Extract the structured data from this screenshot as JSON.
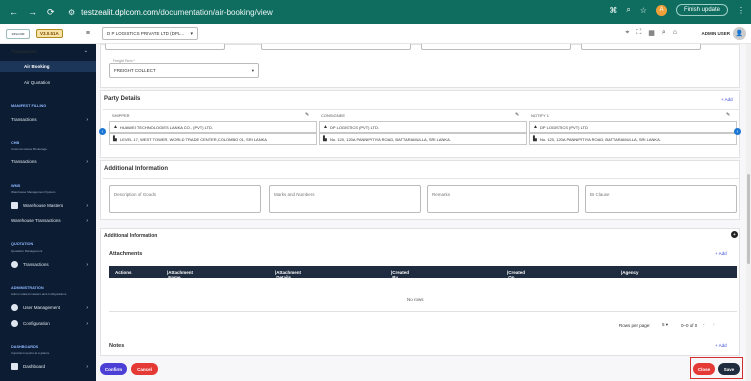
{
  "browser": {
    "url_host": "testzealit.dplcom.com",
    "url_path": "/documentation/air-booking/view",
    "profile_initial": "A",
    "update_label": "Finish update"
  },
  "sidebar": {
    "badge": "V3.0.51A",
    "transactions_label": "Transactions",
    "air_booking": "Air Booking",
    "air_quotation": "Air Quotation",
    "manifest_head": "MANIFEST FILLING",
    "manifest_transactions": "Transactions",
    "chb_head": "CHB",
    "chb_caption": "Customs House Brokerage",
    "chb_transactions": "Transactions",
    "wms_head": "WMS",
    "wms_caption": "Warehouse Management System",
    "warehouse_masters": "Warehouse Masters",
    "warehouse_transactions": "Warehouse Transactions",
    "quotation_head": "QUOTATION",
    "quotation_caption": "Quotation Management",
    "quotation_transactions": "Transactions",
    "admin_head": "ADMINISTRATION",
    "admin_caption": "Admin related masters and configurations",
    "user_management": "User Management",
    "configuration": "Configuration",
    "dash_head": "DASHBOARDS",
    "dash_caption": "Important reports at a glance",
    "dashboard": "Dashboard"
  },
  "topbar": {
    "company": "D P LOGISTICS PRIVATE LTD (DPL...",
    "user": "ADMIN USER"
  },
  "freight": {
    "label": "Freight Term *",
    "value": "FREIGHT COLLECT"
  },
  "party": {
    "title": "Party Details",
    "add": "+ Add",
    "shipper_label": "SHIPPER",
    "consignee_label": "CONSIGNEE",
    "notify_label": "NOTIFY 1",
    "shipper_name": "HUAWEI TECHNOLOGIES LANKA CO., (PVT) LTD.",
    "shipper_addr": "LEVEL 17, WEST TOWER, WORLD TRADE CENTER,COLOMBO 01, SRI LANKA",
    "consignee_name": "DP LOGISTICS (PVT) LTD.",
    "consignee_addr": "No. 120, 120A PANNIPITIYA ROAD, BATTARAMULLA, SRI LANKA.",
    "notify_name": "DP LOGISTICS (PVT) LTD",
    "notify_addr": "No. 120, 120A PANNIPITIYA ROAD, BATTARAMULLA, SRI LANKA."
  },
  "additional": {
    "title": "Additional Information",
    "goods": "Description of Goods",
    "marks": "Marks and Numbers",
    "remarks": "Remarks",
    "bl_clause": "BI Clause"
  },
  "attachments": {
    "section_title": "Additional Information",
    "title": "Attachments",
    "add": "+ Add",
    "columns": [
      "Actions",
      "Attachment Name",
      "Attachment Details",
      "Created By",
      "Created On",
      "Agency"
    ],
    "empty": "No rows",
    "rows_per_page_label": "Rows per page:",
    "rows_per_page": "5",
    "range": "0–0 of 0"
  },
  "notes": {
    "title": "Notes",
    "add": "+ Add"
  },
  "footer": {
    "confirm": "Confirm",
    "cancel": "Cancel",
    "close": "Close",
    "save": "Save"
  },
  "colors": {
    "chrome": "#0f6d60",
    "sidebar": "#0c1d33",
    "confirm": "#4b3fd6",
    "cancel": "#e53935",
    "close": "#e53935",
    "save": "#1f2c3f",
    "highlight": "#d32f2f"
  }
}
